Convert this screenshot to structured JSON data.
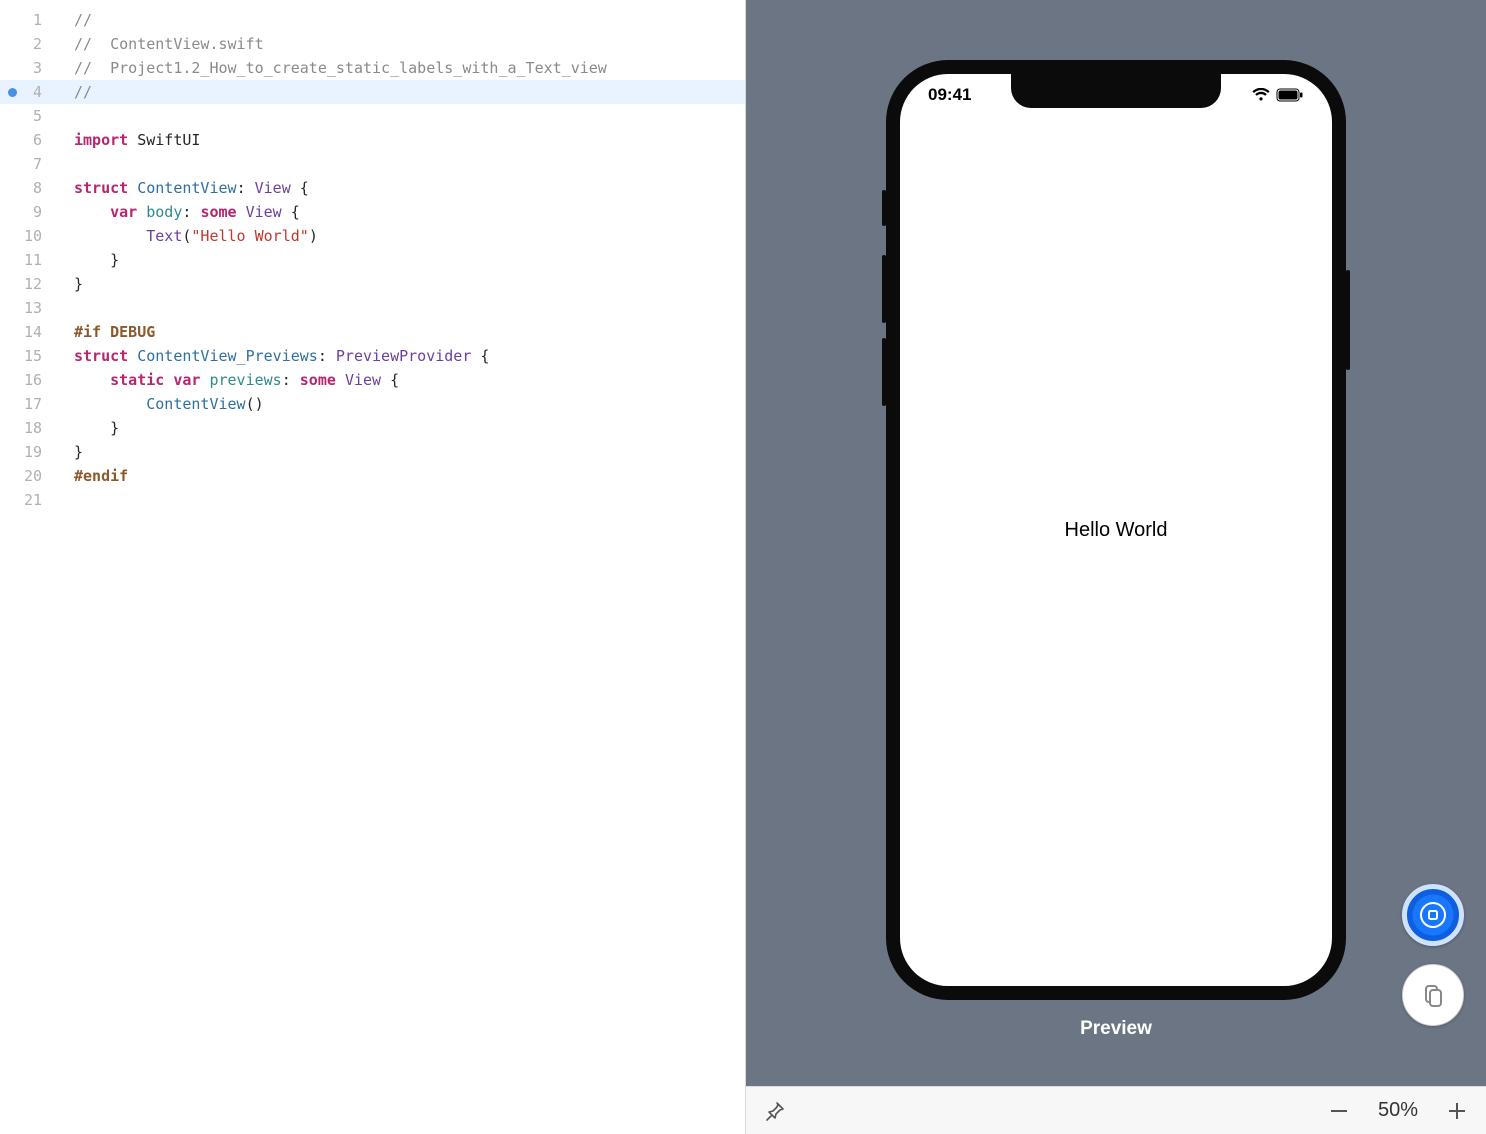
{
  "editor": {
    "highlighted_line_index": 3,
    "lines": [
      {
        "n": 1,
        "tokens": [
          {
            "t": "//",
            "c": "comment"
          }
        ]
      },
      {
        "n": 2,
        "tokens": [
          {
            "t": "//  ContentView.swift",
            "c": "comment"
          }
        ]
      },
      {
        "n": 3,
        "tokens": [
          {
            "t": "//  Project1.2_How_to_create_static_labels_with_a_Text_view",
            "c": "comment"
          }
        ]
      },
      {
        "n": 4,
        "tokens": [
          {
            "t": "//",
            "c": "comment"
          }
        ]
      },
      {
        "n": 5,
        "tokens": []
      },
      {
        "n": 6,
        "tokens": [
          {
            "t": "import",
            "c": "keyword"
          },
          {
            "t": " "
          },
          {
            "t": "SwiftUI",
            "c": ""
          }
        ]
      },
      {
        "n": 7,
        "tokens": []
      },
      {
        "n": 8,
        "tokens": [
          {
            "t": "struct",
            "c": "keyword"
          },
          {
            "t": " "
          },
          {
            "t": "ContentView",
            "c": "ident"
          },
          {
            "t": ": "
          },
          {
            "t": "View",
            "c": "type"
          },
          {
            "t": " {"
          }
        ]
      },
      {
        "n": 9,
        "tokens": [
          {
            "t": "    "
          },
          {
            "t": "var",
            "c": "keyword"
          },
          {
            "t": " "
          },
          {
            "t": "body",
            "c": "teal"
          },
          {
            "t": ": "
          },
          {
            "t": "some",
            "c": "keyword"
          },
          {
            "t": " "
          },
          {
            "t": "View",
            "c": "type"
          },
          {
            "t": " {"
          }
        ]
      },
      {
        "n": 10,
        "tokens": [
          {
            "t": "        "
          },
          {
            "t": "Text",
            "c": "type"
          },
          {
            "t": "("
          },
          {
            "t": "\"Hello World\"",
            "c": "string"
          },
          {
            "t": ")"
          }
        ]
      },
      {
        "n": 11,
        "tokens": [
          {
            "t": "    }"
          }
        ]
      },
      {
        "n": 12,
        "tokens": [
          {
            "t": "}"
          }
        ]
      },
      {
        "n": 13,
        "tokens": []
      },
      {
        "n": 14,
        "tokens": [
          {
            "t": "#if DEBUG",
            "c": "brown"
          }
        ]
      },
      {
        "n": 15,
        "tokens": [
          {
            "t": "struct",
            "c": "keyword"
          },
          {
            "t": " "
          },
          {
            "t": "ContentView_Previews",
            "c": "ident"
          },
          {
            "t": ": "
          },
          {
            "t": "PreviewProvider",
            "c": "type"
          },
          {
            "t": " {"
          }
        ]
      },
      {
        "n": 16,
        "tokens": [
          {
            "t": "    "
          },
          {
            "t": "static",
            "c": "keyword"
          },
          {
            "t": " "
          },
          {
            "t": "var",
            "c": "keyword"
          },
          {
            "t": " "
          },
          {
            "t": "previews",
            "c": "teal"
          },
          {
            "t": ": "
          },
          {
            "t": "some",
            "c": "keyword"
          },
          {
            "t": " "
          },
          {
            "t": "View",
            "c": "type"
          },
          {
            "t": " {"
          }
        ]
      },
      {
        "n": 17,
        "tokens": [
          {
            "t": "        "
          },
          {
            "t": "ContentView",
            "c": "ident"
          },
          {
            "t": "()"
          }
        ]
      },
      {
        "n": 18,
        "tokens": [
          {
            "t": "    }"
          }
        ]
      },
      {
        "n": 19,
        "tokens": [
          {
            "t": "}"
          }
        ]
      },
      {
        "n": 20,
        "tokens": [
          {
            "t": "#endif",
            "c": "brown"
          }
        ]
      },
      {
        "n": 21,
        "tokens": []
      }
    ]
  },
  "preview": {
    "label": "Preview",
    "device_time": "09:41",
    "content_text": "Hello World"
  },
  "bottom_bar": {
    "zoom_level": "50%"
  }
}
